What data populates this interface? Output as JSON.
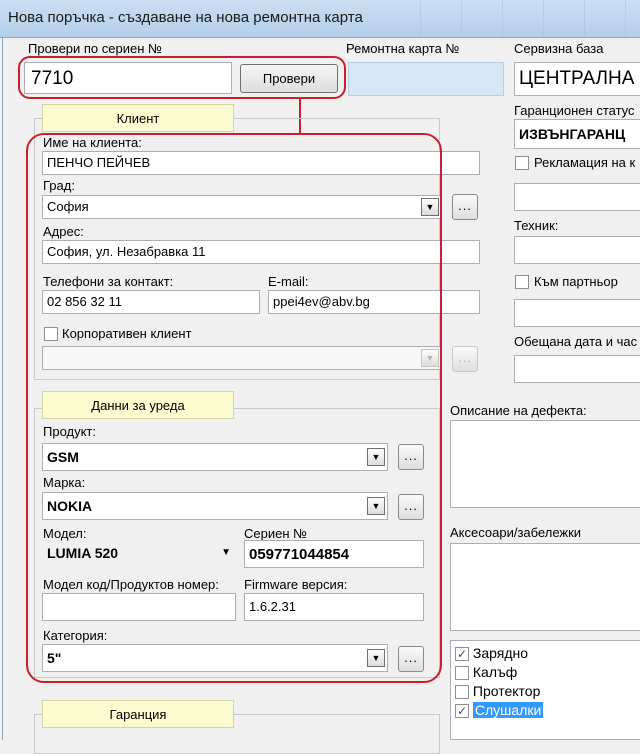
{
  "window": {
    "title": "Нова поръчка - създаване на нова ремонтна карта"
  },
  "serial_check": {
    "label": "Провери по сериен №",
    "value": "7710",
    "button": "Провери"
  },
  "repair_card": {
    "label": "Ремонтна карта №",
    "value": ""
  },
  "service_base": {
    "label": "Сервизна база",
    "value": "ЦЕНТРАЛНА"
  },
  "warranty_status": {
    "label": "Гаранционен статус",
    "value": "ИЗВЪНГАРАНЦ"
  },
  "complaint": {
    "label": "Рекламация на к",
    "checked": false
  },
  "technician": {
    "label": "Техник:"
  },
  "to_partner": {
    "label": "Към партньор",
    "checked": false
  },
  "promised_date": {
    "label": "Обещана дата и час"
  },
  "client": {
    "tab": "Клиент",
    "name_label": "Име на клиента:",
    "name": "ПЕНЧО ПЕЙЧЕВ",
    "city_label": "Град:",
    "city": "София",
    "address_label": "Адрес:",
    "address": "София, ул. Незабравка 11",
    "phones_label": "Телефони за контакт:",
    "phones": "02 856 32 11",
    "email_label": "E-mail:",
    "email": "ppei4ev@abv.bg",
    "corporate_label": "Корпоративен клиент",
    "corporate_checked": false
  },
  "device": {
    "tab": "Данни за уреда",
    "product_label": "Продукт:",
    "product": "GSM",
    "brand_label": "Марка:",
    "brand": "NOKIA",
    "model_label": "Модел:",
    "model": "LUMIA 520",
    "serial_label": "Сериен №",
    "serial": "059771044854",
    "model_code_label": "Модел код/Продуктов номер:",
    "model_code": "",
    "firmware_label": "Firmware версия:",
    "firmware": "1.6.2.31",
    "category_label": "Категория:",
    "category": "5\""
  },
  "defect": {
    "label": "Описание на дефекта:"
  },
  "accessories": {
    "label": "Аксесоари/забележки",
    "items": [
      {
        "label": "Зарядно",
        "checked": true,
        "selected": false
      },
      {
        "label": "Калъф",
        "checked": false,
        "selected": false
      },
      {
        "label": "Протектор",
        "checked": false,
        "selected": false
      },
      {
        "label": "Слушалки",
        "checked": true,
        "selected": true
      }
    ]
  },
  "warranty": {
    "tab": "Гаранция"
  },
  "icons": {
    "dropdown": "chevron-down-icon",
    "browse": "ellipsis-icon",
    "check": "checkmark-icon"
  },
  "colors": {
    "highlight_outline": "#c8202a",
    "section_tab_bg": "#fdfbd0",
    "selection": "#3399ff"
  }
}
